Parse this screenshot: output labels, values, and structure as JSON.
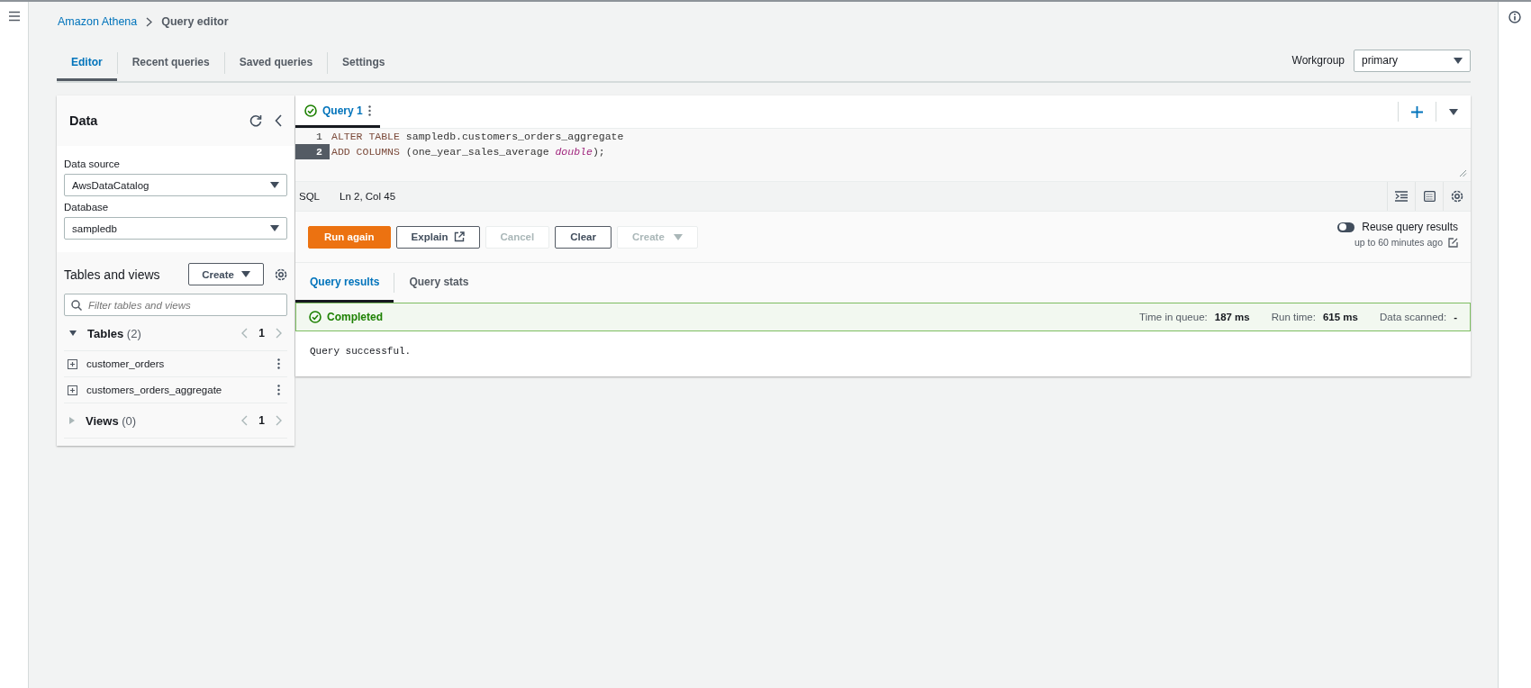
{
  "breadcrumb": [
    {
      "label": "Amazon Athena",
      "kind": "link"
    },
    {
      "label": "Query editor",
      "kind": "current"
    }
  ],
  "tabs": [
    {
      "label": "Editor",
      "selected": true
    },
    {
      "label": "Recent queries",
      "selected": false
    },
    {
      "label": "Saved queries",
      "selected": false
    },
    {
      "label": "Settings",
      "selected": false
    }
  ],
  "workgroup": {
    "label": "Workgroup",
    "value": "primary"
  },
  "data_panel": {
    "title": "Data",
    "data_source": {
      "label": "Data source",
      "value": "AwsDataCatalog"
    },
    "database": {
      "label": "Database",
      "value": "sampledb"
    },
    "tables_title": "Tables and views",
    "create_button": "Create",
    "filter": {
      "placeholder": "Filter tables and views"
    },
    "groups": [
      {
        "name": "Tables",
        "count": "(2)",
        "expanded": true,
        "page": "1",
        "children": [
          {
            "name": "customer_orders"
          },
          {
            "name": "customers_orders_aggregate"
          }
        ]
      },
      {
        "name": "Views",
        "count": "(0)",
        "expanded": false,
        "page": "1"
      }
    ]
  },
  "query_tabs": [
    {
      "label": "Query 1",
      "selected": true
    }
  ],
  "editor": {
    "lines": [
      {
        "number": "1",
        "current": false,
        "tokens": [
          {
            "text": "ALTER TABLE",
            "kind": "keyword"
          },
          {
            "text": " sampledb.customers_orders_aggregate",
            "kind": "plain"
          }
        ]
      },
      {
        "number": "2",
        "current": true,
        "tokens": [
          {
            "text": "ADD COLUMNS",
            "kind": "keyword"
          },
          {
            "text": " (one_year_sales_average ",
            "kind": "plain"
          },
          {
            "text": "double",
            "kind": "type"
          },
          {
            "text": ");",
            "kind": "plain"
          }
        ]
      }
    ]
  },
  "status_bar": {
    "language": "SQL",
    "position": "Ln 2, Col 45"
  },
  "actions": [
    {
      "label": "Run again",
      "kind": "primary",
      "disabled": false
    },
    {
      "label": "Explain",
      "kind": "external",
      "disabled": false
    },
    {
      "label": "Cancel",
      "kind": "normal",
      "disabled": true
    },
    {
      "label": "Clear",
      "kind": "normal",
      "disabled": false
    },
    {
      "label": "Create",
      "kind": "dropdown",
      "disabled": true
    }
  ],
  "reuse": {
    "label": "Reuse query results",
    "on": false,
    "note": "up to 60 minutes ago"
  },
  "result_tabs": [
    {
      "label": "Query results",
      "selected": true
    },
    {
      "label": "Query stats",
      "selected": false
    }
  ],
  "status": {
    "label": "Completed",
    "kind": "success",
    "stats": [
      {
        "label": "Time in queue:",
        "value": "187 ms"
      },
      {
        "label": "Run time:",
        "value": "615 ms"
      },
      {
        "label": "Data scanned:",
        "value": "-"
      }
    ]
  },
  "message": "Query successful."
}
